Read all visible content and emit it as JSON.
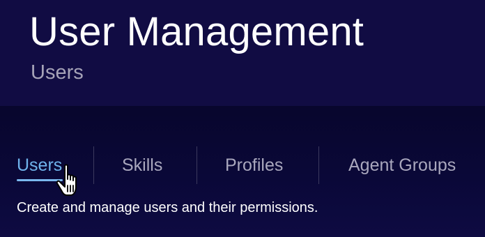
{
  "header": {
    "title": "User Management",
    "subtitle": "Users"
  },
  "tabs": [
    {
      "label": "Users",
      "active": true
    },
    {
      "label": "Skills",
      "active": false
    },
    {
      "label": "Profiles",
      "active": false
    },
    {
      "label": "Agent Groups",
      "active": false
    }
  ],
  "tab_description": "Create and manage users and their permissions.",
  "colors": {
    "header_background": "#110c43",
    "content_background": "#080633",
    "active_tab": "#6fb3ec",
    "inactive_tab": "#a9a7bd",
    "subtitle": "#a6a3b8"
  },
  "cursor": {
    "icon": "hand-pointer-icon"
  }
}
